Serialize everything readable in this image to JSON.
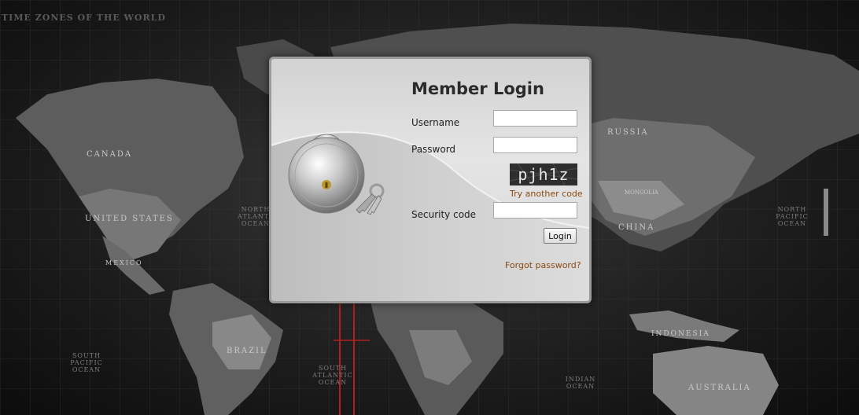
{
  "map": {
    "title": "TIME ZONES OF THE WORLD",
    "labels": {
      "canada": "CANADA",
      "united_states": "UNITED STATES",
      "mexico": "MEXICO",
      "brazil": "BRAZIL",
      "russia": "RUSSIA",
      "china": "CHINA",
      "mongolia": "MONGOLIA",
      "indonesia": "INDONESIA",
      "australia": "AUSTRALIA",
      "north_atlantic": "NORTH ATLANTIC OCEAN",
      "south_atlantic": "SOUTH ATLANTIC OCEAN",
      "south_pacific": "SOUTH PACIFIC OCEAN",
      "north_pacific": "NORTH PACIFIC OCEAN",
      "indian_ocean": "INDIAN OCEAN"
    }
  },
  "login": {
    "title": "Member Login",
    "username_label": "Username",
    "username_value": "",
    "password_label": "Password",
    "password_value": "",
    "captcha_text": "pjh1z",
    "try_another_code": "Try another code",
    "security_code_label": "Security code",
    "security_code_value": "",
    "login_button": "Login",
    "forgot_password": "Forgot password?"
  },
  "colors": {
    "link": "#8a4a12",
    "panel_border": "#9a9a9a"
  },
  "icons": {
    "lock": "padlock-icon"
  }
}
